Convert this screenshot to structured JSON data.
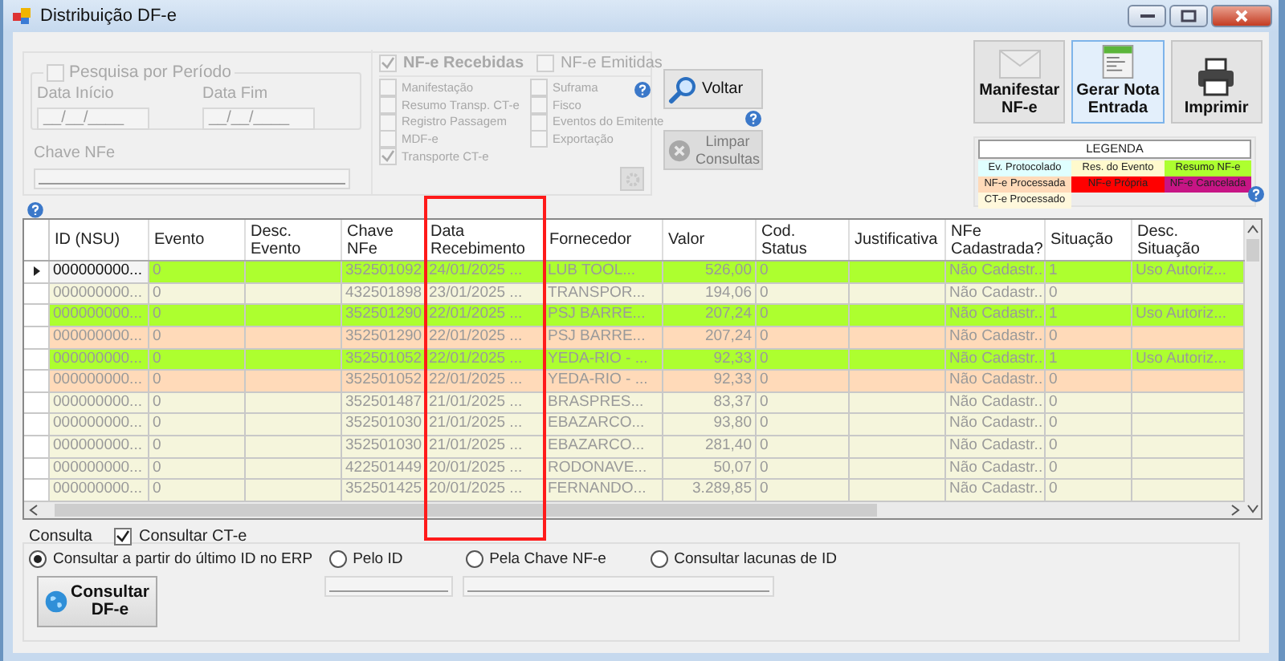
{
  "window": {
    "title": "Distribuição DF-e"
  },
  "period": {
    "label": "Pesquisa por Período",
    "checked": false,
    "disabled": true,
    "start_label": "Data Início",
    "start_value": "__/__/____",
    "end_label": "Data Fim",
    "end_value": "__/__/____",
    "key_label": "Chave NFe"
  },
  "doc_types": [
    {
      "label": "NF-e Recebidas",
      "checked": true
    },
    {
      "label": "NF-e Emitidas",
      "checked": false
    }
  ],
  "event_filters": [
    {
      "label": "Manifestação",
      "checked": false
    },
    {
      "label": "Suframa",
      "checked": false
    },
    {
      "label": "Resumo Transp. CT-e",
      "checked": false
    },
    {
      "label": "Fisco",
      "checked": false
    },
    {
      "label": "Registro Passagem",
      "checked": false
    },
    {
      "label": "Eventos do Emitente",
      "checked": false
    },
    {
      "label": "MDF-e",
      "checked": false
    },
    {
      "label": "Exportação",
      "checked": false
    },
    {
      "label": "Transporte CT-e",
      "checked": true
    }
  ],
  "actions": [
    {
      "label": "Voltar",
      "kind": "search",
      "disabled": false
    },
    {
      "label": "Limpar\nConsultas",
      "kind": "clear",
      "disabled": true
    }
  ],
  "toolbar": [
    {
      "label": "Manifestar\nNF-e",
      "kind": "envelope",
      "hovered": false
    },
    {
      "label": "Gerar Nota\nEntrada",
      "kind": "document",
      "hovered": true
    },
    {
      "label": "Imprimir",
      "kind": "printer",
      "hovered": false
    }
  ],
  "legend": {
    "title": "LEGENDA",
    "items": [
      {
        "label": "Ev. Protocolado",
        "color": "#e0ffff"
      },
      {
        "label": "Res. do Evento",
        "color": "#fffacd"
      },
      {
        "label": "Resumo NF-e",
        "color": "#adff2f"
      },
      {
        "label": "NF-e Processada",
        "color": "#ffdab9"
      },
      {
        "label": "NF-e Própria",
        "color": "#ff0000"
      },
      {
        "label": "NF-e Cancelada",
        "color": "#c71585"
      },
      {
        "label": "CT-e Processado",
        "color": "#fff8dc"
      }
    ]
  },
  "table": {
    "columns": [
      "ID (NSU)",
      "Evento",
      "Desc.\nEvento",
      "Chave\nNFe",
      "Data\nRecebimento",
      "Fornecedor",
      "Valor",
      "Cod.\nStatus",
      "Justificativa",
      "NFe\nCadastrada?",
      "Situação",
      "Desc.\nSituação"
    ],
    "rows": [
      {
        "selected": true,
        "color": "#adff2f",
        "cells": [
          "000000000...",
          "0",
          null,
          "352501092",
          "24/01/2025 ...",
          "LUB TOOL...",
          "526,00",
          "0",
          null,
          "Não Cadastr...",
          "1",
          "Uso Autoriz..."
        ]
      },
      {
        "selected": false,
        "color": "#f5f5dc",
        "cells": [
          "000000000...",
          "0",
          null,
          "432501898",
          "23/01/2025 ...",
          "TRANSPOR...",
          "194,06",
          "0",
          null,
          "Não Cadastr...",
          "0",
          null
        ]
      },
      {
        "selected": false,
        "color": "#adff2f",
        "cells": [
          "000000000...",
          "0",
          null,
          "352501290",
          "22/01/2025 ...",
          "PSJ BARRE...",
          "207,24",
          "0",
          null,
          "Não Cadastr...",
          "1",
          "Uso Autoriz..."
        ]
      },
      {
        "selected": false,
        "color": "#ffdab9",
        "cells": [
          "000000000...",
          "0",
          null,
          "352501290",
          "22/01/2025 ...",
          "PSJ BARRE...",
          "207,24",
          "0",
          null,
          "Não Cadastr...",
          "0",
          null
        ]
      },
      {
        "selected": false,
        "color": "#adff2f",
        "cells": [
          "000000000...",
          "0",
          null,
          "352501052",
          "22/01/2025 ...",
          "YEDA-RIO - ...",
          "92,33",
          "0",
          null,
          "Não Cadastr...",
          "1",
          "Uso Autoriz..."
        ]
      },
      {
        "selected": false,
        "color": "#ffdab9",
        "cells": [
          "000000000...",
          "0",
          null,
          "352501052",
          "22/01/2025 ...",
          "YEDA-RIO - ...",
          "92,33",
          "0",
          null,
          "Não Cadastr...",
          "0",
          null
        ]
      },
      {
        "selected": false,
        "color": "#f5f5dc",
        "cells": [
          "000000000...",
          "0",
          null,
          "352501487",
          "21/01/2025 ...",
          "BRASPRES...",
          "83,37",
          "0",
          null,
          "Não Cadastr...",
          "0",
          null
        ]
      },
      {
        "selected": false,
        "color": "#f5f5dc",
        "cells": [
          "000000000...",
          "0",
          null,
          "352501030",
          "21/01/2025 ...",
          "EBAZARCO...",
          "93,80",
          "0",
          null,
          "Não Cadastr...",
          "0",
          null
        ]
      },
      {
        "selected": false,
        "color": "#f5f5dc",
        "cells": [
          "000000000...",
          "0",
          null,
          "352501030",
          "21/01/2025 ...",
          "EBAZARCO...",
          "281,40",
          "0",
          null,
          "Não Cadastr...",
          "0",
          null
        ]
      },
      {
        "selected": false,
        "color": "#f5f5dc",
        "cells": [
          "000000000...",
          "0",
          null,
          "422501449",
          "20/01/2025 ...",
          "RODONAVE...",
          "50,07",
          "0",
          null,
          "Não Cadastr...",
          "0",
          null
        ]
      },
      {
        "selected": false,
        "color": "#f5f5dc",
        "cells": [
          "000000000...",
          "0",
          null,
          "352501425",
          "20/01/2025 ...",
          "FERNANDO...",
          "3.289,85",
          "0",
          null,
          "Não Cadastr...",
          "0",
          null
        ]
      }
    ]
  },
  "consult": {
    "group": "Consulta",
    "cte": {
      "label": "Consultar CT-e",
      "checked": true
    },
    "modes": [
      {
        "label": "Consultar a partir do último ID no ERP",
        "selected": true
      },
      {
        "label": "Pelo ID",
        "selected": false
      },
      {
        "label": "Pela Chave NF-e",
        "selected": false
      },
      {
        "label": "Consultar lacunas de ID",
        "selected": false
      }
    ],
    "button": "Consultar\nDF-e"
  }
}
